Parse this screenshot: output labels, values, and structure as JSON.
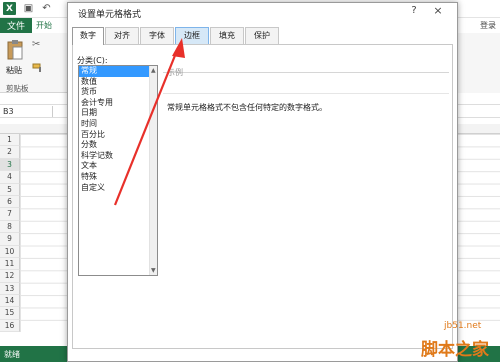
{
  "excel": {
    "file_tab": "文件",
    "home_tab": "开始",
    "login": "登录",
    "paste_label": "粘贴",
    "clipboard_label": "剪贴板",
    "name_box": "B3",
    "rows": [
      "1",
      "2",
      "3",
      "4",
      "5",
      "6",
      "7",
      "8",
      "9",
      "10",
      "11",
      "12",
      "13",
      "14",
      "15",
      "16"
    ],
    "selected_row": "3",
    "status": "就绪"
  },
  "dialog": {
    "title": "设置单元格格式",
    "help": "?",
    "close": "×",
    "tabs": [
      {
        "label": "数字"
      },
      {
        "label": "对齐"
      },
      {
        "label": "字体"
      },
      {
        "label": "边框"
      },
      {
        "label": "填充"
      },
      {
        "label": "保护"
      }
    ],
    "active_tab": "数字",
    "hover_tab": "边框",
    "category_label": "分类(C):",
    "categories": [
      "常规",
      "数值",
      "货币",
      "会计专用",
      "日期",
      "时间",
      "百分比",
      "分数",
      "科学记数",
      "文本",
      "特殊",
      "自定义"
    ],
    "selected_category": "常规",
    "sample_label": "示例",
    "description": "常规单元格格式不包含任何特定的数字格式。"
  },
  "annotation": {
    "arrow_color": "#e8302a"
  },
  "watermark": {
    "url": "jb51.net",
    "brand": "脚本之家"
  },
  "colors": {
    "excel_green": "#217346",
    "selection_blue": "#3399ff"
  }
}
